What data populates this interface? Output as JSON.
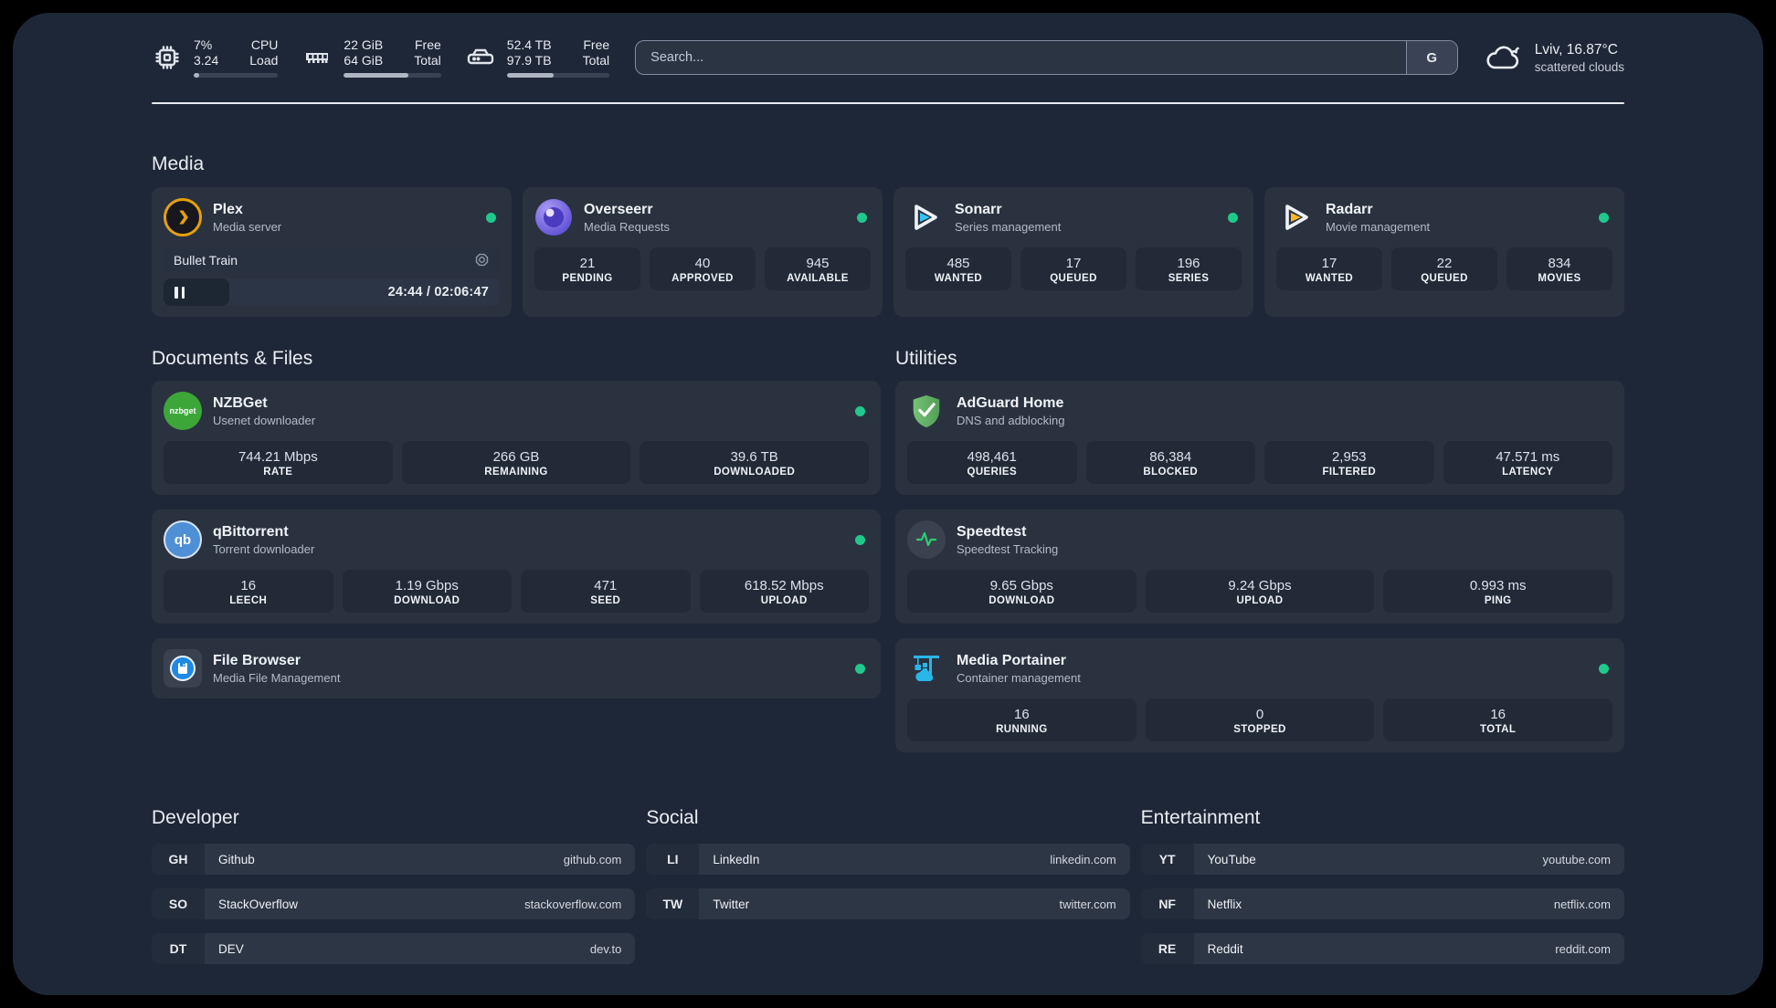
{
  "colors": {
    "background": "#1e2737",
    "card": "#2a3240",
    "stat_box": "#222a38",
    "online_green": "#1fc98c",
    "plex_orange": "#e5a00d",
    "sonarr_blue": "#35c5f4",
    "radarr_yellow": "#ffb626",
    "nzbget_green": "#3da639",
    "qbittorrent_blue": "#4f8fd5",
    "filebrowser_blue": "#1e88e5",
    "adguard_green": "#67b569",
    "speedtest_green": "#2ecc71",
    "portainer_blue": "#29b6e8"
  },
  "header": {
    "metrics": [
      {
        "icon": "cpu-icon",
        "v1": "7%",
        "v2": "3.24",
        "l1": "CPU",
        "l2": "Load",
        "progress": 7
      },
      {
        "icon": "memory-icon",
        "v1": "22 GiB",
        "v2": "64 GiB",
        "l1": "Free",
        "l2": "Total",
        "progress": 66
      },
      {
        "icon": "disk-icon",
        "v1": "52.4 TB",
        "v2": "97.9 TB",
        "l1": "Free",
        "l2": "Total",
        "progress": 46
      }
    ],
    "search": {
      "placeholder": "Search...",
      "engine_label": "G"
    },
    "weather": {
      "location_temp": "Lviv, 16.87°C",
      "condition": "scattered clouds",
      "icon": "cloud-icon"
    }
  },
  "media": {
    "title": "Media",
    "plex": {
      "name": "Plex",
      "subtitle": "Media server",
      "online": true,
      "player": {
        "track": "Bullet Train",
        "time_display": "24:44 / 02:06:47",
        "elapsed": "24:44",
        "duration": "02:06:47",
        "progress_pct": 19.5
      }
    },
    "overseerr": {
      "name": "Overseerr",
      "subtitle": "Media Requests",
      "online": true,
      "stats": [
        {
          "value": "21",
          "label": "PENDING"
        },
        {
          "value": "40",
          "label": "APPROVED"
        },
        {
          "value": "945",
          "label": "AVAILABLE"
        }
      ]
    },
    "sonarr": {
      "name": "Sonarr",
      "subtitle": "Series management",
      "online": true,
      "stats": [
        {
          "value": "485",
          "label": "WANTED"
        },
        {
          "value": "17",
          "label": "QUEUED"
        },
        {
          "value": "196",
          "label": "SERIES"
        }
      ]
    },
    "radarr": {
      "name": "Radarr",
      "subtitle": "Movie management",
      "online": true,
      "stats": [
        {
          "value": "17",
          "label": "WANTED"
        },
        {
          "value": "22",
          "label": "QUEUED"
        },
        {
          "value": "834",
          "label": "MOVIES"
        }
      ]
    }
  },
  "documents": {
    "title": "Documents & Files",
    "nzbget": {
      "name": "NZBGet",
      "subtitle": "Usenet downloader",
      "online": true,
      "icon_text": "nzbget",
      "stats": [
        {
          "value": "744.21 Mbps",
          "label": "RATE"
        },
        {
          "value": "266 GB",
          "label": "REMAINING"
        },
        {
          "value": "39.6 TB",
          "label": "DOWNLOADED"
        }
      ]
    },
    "qbittorrent": {
      "name": "qBittorrent",
      "subtitle": "Torrent downloader",
      "online": true,
      "icon_text": "qb",
      "stats": [
        {
          "value": "16",
          "label": "LEECH"
        },
        {
          "value": "1.19 Gbps",
          "label": "DOWNLOAD"
        },
        {
          "value": "471",
          "label": "SEED"
        },
        {
          "value": "618.52 Mbps",
          "label": "UPLOAD"
        }
      ]
    },
    "filebrowser": {
      "name": "File Browser",
      "subtitle": "Media File Management",
      "online": true
    }
  },
  "utilities": {
    "title": "Utilities",
    "adguard": {
      "name": "AdGuard Home",
      "subtitle": "DNS and adblocking",
      "stats": [
        {
          "value": "498,461",
          "label": "QUERIES"
        },
        {
          "value": "86,384",
          "label": "BLOCKED"
        },
        {
          "value": "2,953",
          "label": "FILTERED"
        },
        {
          "value": "47.571 ms",
          "label": "LATENCY"
        }
      ]
    },
    "speedtest": {
      "name": "Speedtest",
      "subtitle": "Speedtest Tracking",
      "stats": [
        {
          "value": "9.65 Gbps",
          "label": "DOWNLOAD"
        },
        {
          "value": "9.24 Gbps",
          "label": "UPLOAD"
        },
        {
          "value": "0.993 ms",
          "label": "PING"
        }
      ]
    },
    "portainer": {
      "name": "Media Portainer",
      "subtitle": "Container management",
      "online": true,
      "stats": [
        {
          "value": "16",
          "label": "RUNNING"
        },
        {
          "value": "0",
          "label": "STOPPED"
        },
        {
          "value": "16",
          "label": "TOTAL"
        }
      ]
    }
  },
  "bookmarks": [
    {
      "title": "Developer",
      "links": [
        {
          "abbr": "GH",
          "name": "Github",
          "url": "github.com"
        },
        {
          "abbr": "SO",
          "name": "StackOverflow",
          "url": "stackoverflow.com"
        },
        {
          "abbr": "DT",
          "name": "DEV",
          "url": "dev.to"
        }
      ]
    },
    {
      "title": "Social",
      "links": [
        {
          "abbr": "LI",
          "name": "LinkedIn",
          "url": "linkedin.com"
        },
        {
          "abbr": "TW",
          "name": "Twitter",
          "url": "twitter.com"
        }
      ]
    },
    {
      "title": "Entertainment",
      "links": [
        {
          "abbr": "YT",
          "name": "YouTube",
          "url": "youtube.com"
        },
        {
          "abbr": "NF",
          "name": "Netflix",
          "url": "netflix.com"
        },
        {
          "abbr": "RE",
          "name": "Reddit",
          "url": "reddit.com"
        }
      ]
    }
  ]
}
